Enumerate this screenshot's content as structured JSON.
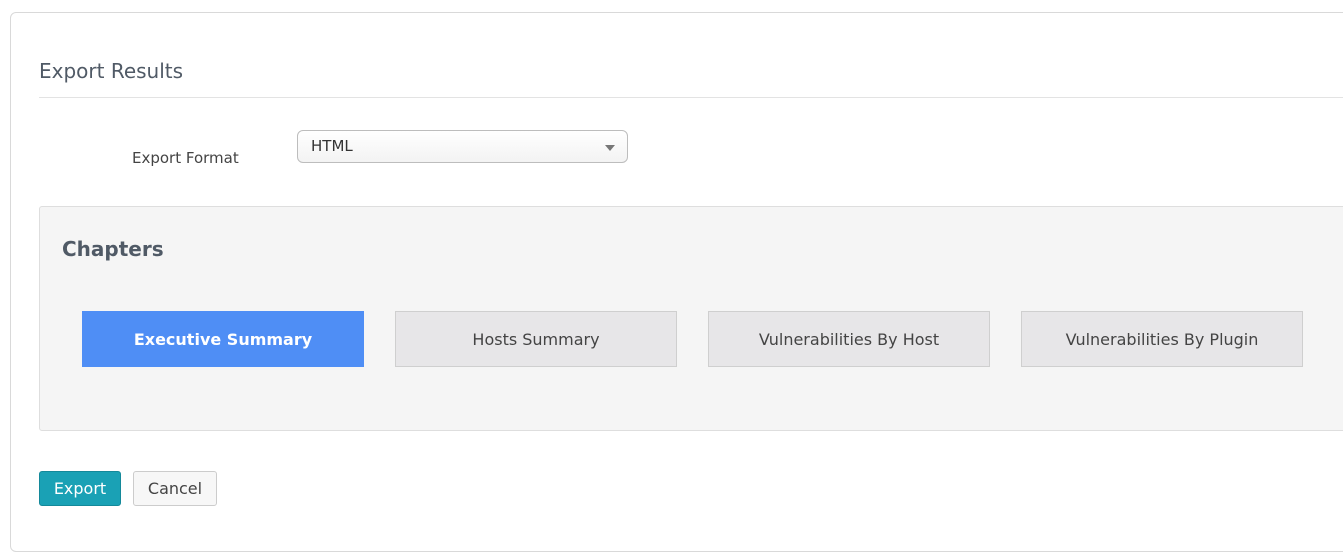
{
  "dialog": {
    "title": "Export Results"
  },
  "export_format": {
    "label": "Export Format",
    "selected": "HTML"
  },
  "chapters": {
    "title": "Chapters",
    "items": [
      {
        "label": "Executive Summary",
        "active": true
      },
      {
        "label": "Hosts Summary",
        "active": false
      },
      {
        "label": "Vulnerabilities By Host",
        "active": false
      },
      {
        "label": "Vulnerabilities By Plugin",
        "active": false
      }
    ]
  },
  "actions": {
    "export_label": "Export",
    "cancel_label": "Cancel"
  },
  "colors": {
    "active_chapter": "#4f8ef5",
    "export_button": "#1aa1b5"
  }
}
